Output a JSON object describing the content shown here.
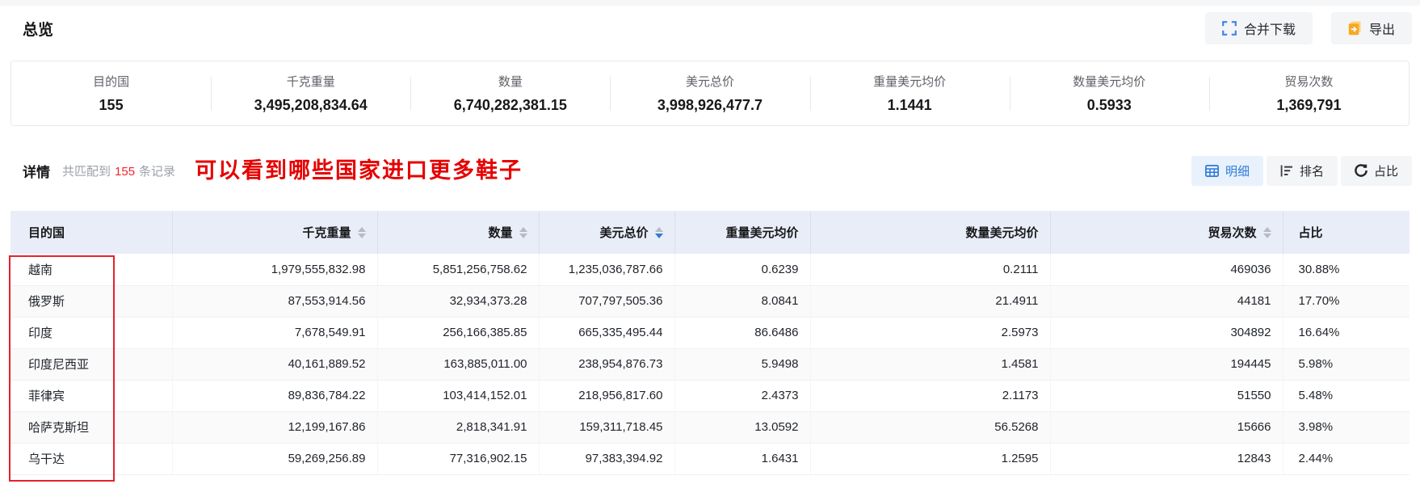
{
  "overview": {
    "title": "总览",
    "actions": {
      "merge_download": {
        "label": "合并下载",
        "icon": "merge-download-icon"
      },
      "export": {
        "label": "导出",
        "icon": "export-icon"
      }
    },
    "stats": [
      {
        "label": "目的国",
        "value": "155"
      },
      {
        "label": "千克重量",
        "value": "3,495,208,834.64"
      },
      {
        "label": "数量",
        "value": "6,740,282,381.15"
      },
      {
        "label": "美元总价",
        "value": "3,998,926,477.7"
      },
      {
        "label": "重量美元均价",
        "value": "1.1441"
      },
      {
        "label": "数量美元均价",
        "value": "0.5933"
      },
      {
        "label": "贸易次数",
        "value": "1,369,791"
      }
    ]
  },
  "details": {
    "title": "详情",
    "match_prefix": "共匹配到",
    "match_count": "155",
    "match_suffix": "条记录",
    "annotation": "可以看到哪些国家进口更多鞋子",
    "annotation_color": "#e60000",
    "view_tabs": [
      {
        "label": "明细",
        "icon": "table-detail-icon",
        "active": true
      },
      {
        "label": "排名",
        "icon": "ranking-icon",
        "active": false
      },
      {
        "label": "占比",
        "icon": "proportion-icon",
        "active": false
      }
    ]
  },
  "table": {
    "columns": [
      {
        "label": "目的国",
        "align": "left",
        "sortable": false,
        "sort": "none"
      },
      {
        "label": "千克重量",
        "align": "right",
        "sortable": true,
        "sort": "none"
      },
      {
        "label": "数量",
        "align": "right",
        "sortable": true,
        "sort": "none"
      },
      {
        "label": "美元总价",
        "align": "right",
        "sortable": true,
        "sort": "desc"
      },
      {
        "label": "重量美元均价",
        "align": "right",
        "sortable": false,
        "sort": "none"
      },
      {
        "label": "数量美元均价",
        "align": "right",
        "sortable": false,
        "sort": "none"
      },
      {
        "label": "贸易次数",
        "align": "right",
        "sortable": true,
        "sort": "none"
      },
      {
        "label": "占比",
        "align": "left",
        "sortable": false,
        "sort": "none"
      }
    ],
    "rows": [
      {
        "country": "越南",
        "weight_kg": "1,979,555,832.98",
        "quantity": "5,851,256,758.62",
        "usd_total": "1,235,036,787.66",
        "usd_per_kg": "0.6239",
        "usd_per_unit": "0.2111",
        "trade_count": "469036",
        "share": "30.88%"
      },
      {
        "country": "俄罗斯",
        "weight_kg": "87,553,914.56",
        "quantity": "32,934,373.28",
        "usd_total": "707,797,505.36",
        "usd_per_kg": "8.0841",
        "usd_per_unit": "21.4911",
        "trade_count": "44181",
        "share": "17.70%"
      },
      {
        "country": "印度",
        "weight_kg": "7,678,549.91",
        "quantity": "256,166,385.85",
        "usd_total": "665,335,495.44",
        "usd_per_kg": "86.6486",
        "usd_per_unit": "2.5973",
        "trade_count": "304892",
        "share": "16.64%"
      },
      {
        "country": "印度尼西亚",
        "weight_kg": "40,161,889.52",
        "quantity": "163,885,011.00",
        "usd_total": "238,954,876.73",
        "usd_per_kg": "5.9498",
        "usd_per_unit": "1.4581",
        "trade_count": "194445",
        "share": "5.98%"
      },
      {
        "country": "菲律宾",
        "weight_kg": "89,836,784.22",
        "quantity": "103,414,152.01",
        "usd_total": "218,956,817.60",
        "usd_per_kg": "2.4373",
        "usd_per_unit": "2.1173",
        "trade_count": "51550",
        "share": "5.48%"
      },
      {
        "country": "哈萨克斯坦",
        "weight_kg": "12,199,167.86",
        "quantity": "2,818,341.91",
        "usd_total": "159,311,718.45",
        "usd_per_kg": "13.0592",
        "usd_per_unit": "56.5268",
        "trade_count": "15666",
        "share": "3.98%"
      },
      {
        "country": "乌干达",
        "weight_kg": "59,269,256.89",
        "quantity": "77,316,902.15",
        "usd_total": "97,383,394.92",
        "usd_per_kg": "1.6431",
        "usd_per_unit": "1.2595",
        "trade_count": "12843",
        "share": "2.44%"
      }
    ]
  },
  "colors": {
    "header_bg": "#e9edf8",
    "active_tab_bg": "#e8f1fc",
    "accent_blue": "#2e7bd6",
    "annotation_red": "#e60000",
    "count_red": "#f5222d",
    "export_orange": "#f9a825"
  }
}
